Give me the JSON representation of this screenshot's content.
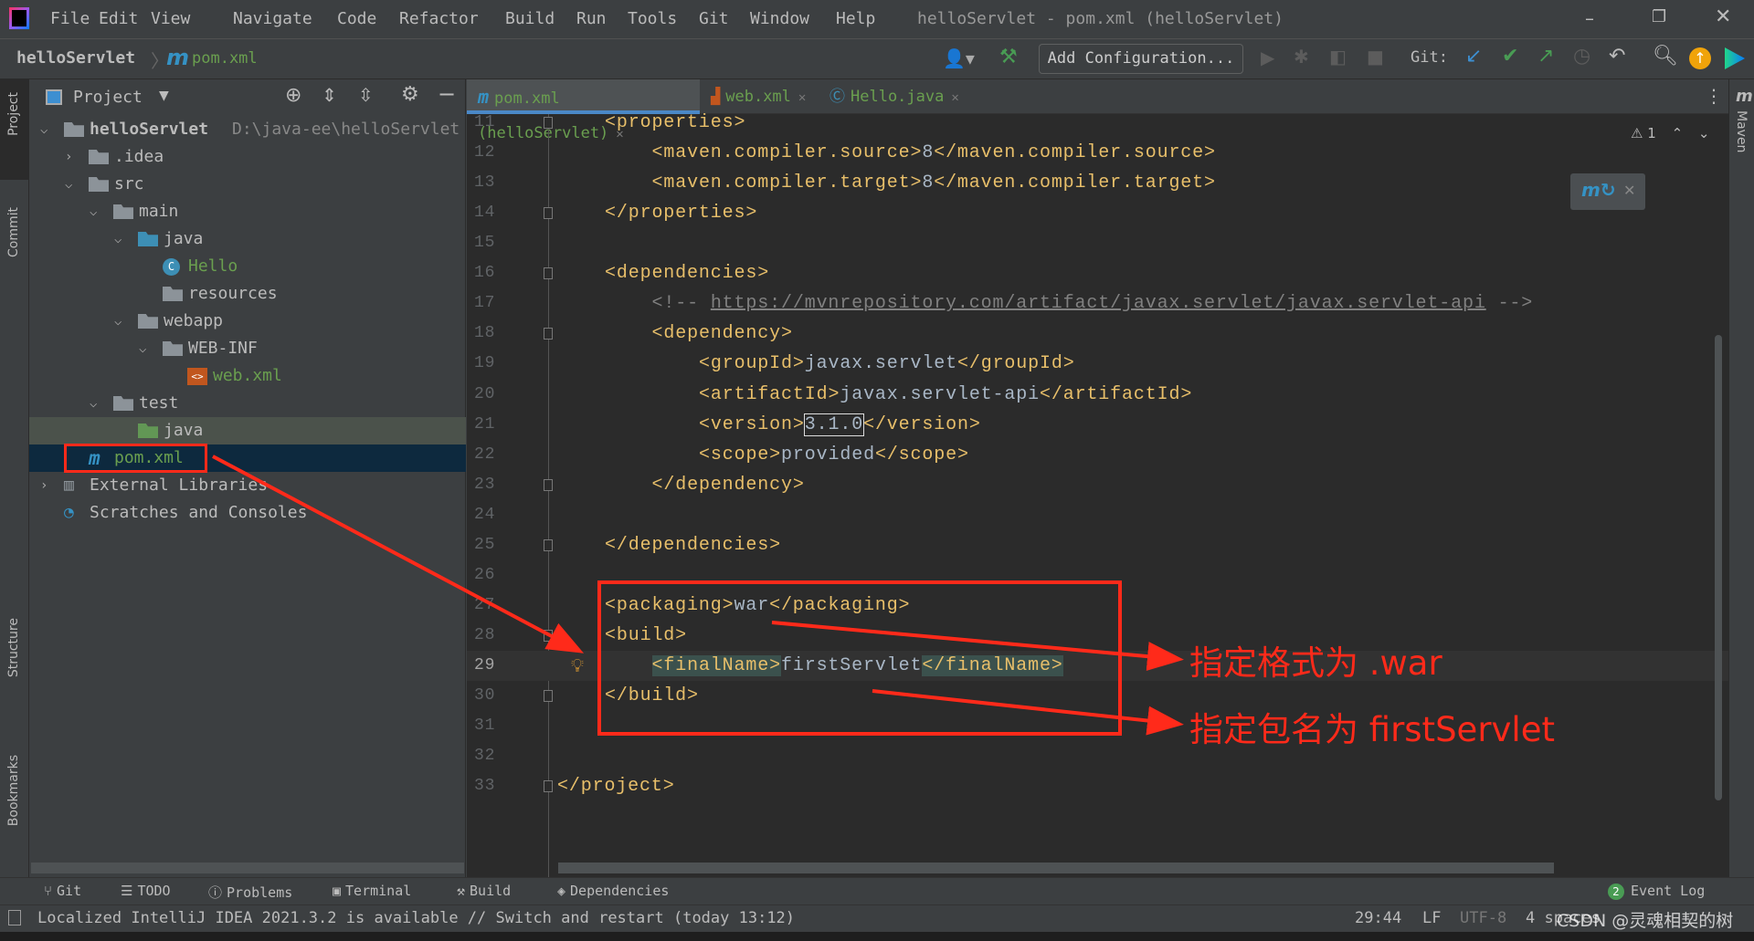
{
  "window": {
    "title": "helloServlet - pom.xml (helloServlet)"
  },
  "menu": [
    "File",
    "Edit",
    "View",
    "Navigate",
    "Code",
    "Refactor",
    "Build",
    "Run",
    "Tools",
    "Git",
    "Window",
    "Help"
  ],
  "breadcrumb": {
    "project": "helloServlet",
    "file": "pom.xml"
  },
  "toolbar": {
    "add_config": "Add Configuration...",
    "git_label": "Git:"
  },
  "left_stripe": [
    "Project",
    "Commit",
    "Structure",
    "Bookmarks"
  ],
  "right_stripe": [
    "Maven"
  ],
  "project_panel": {
    "title": "Project",
    "tree": [
      {
        "label": "helloServlet",
        "path": "D:\\java-ee\\helloServlet",
        "depth": 0,
        "arrow": "down",
        "icon": "module",
        "color": "#bbbbbb",
        "bold": true
      },
      {
        "label": ".idea",
        "depth": 1,
        "arrow": "right",
        "icon": "folder",
        "color": "#bbbbbb"
      },
      {
        "label": "src",
        "depth": 1,
        "arrow": "down",
        "icon": "folder",
        "color": "#bbbbbb"
      },
      {
        "label": "main",
        "depth": 2,
        "arrow": "down",
        "icon": "folder",
        "color": "#bbbbbb"
      },
      {
        "label": "java",
        "depth": 3,
        "arrow": "down",
        "icon": "folder-blue",
        "color": "#bbbbbb"
      },
      {
        "label": "Hello",
        "depth": 4,
        "arrow": "",
        "icon": "class",
        "color": "#6a9f4f"
      },
      {
        "label": "resources",
        "depth": 4,
        "arrow": "",
        "icon": "folder-res",
        "color": "#bbbbbb"
      },
      {
        "label": "webapp",
        "depth": 3,
        "arrow": "down",
        "icon": "folder",
        "color": "#bbbbbb"
      },
      {
        "label": "WEB-INF",
        "depth": 4,
        "arrow": "down",
        "icon": "folder",
        "color": "#bbbbbb"
      },
      {
        "label": "web.xml",
        "depth": 5,
        "arrow": "",
        "icon": "xml",
        "color": "#6a9f4f"
      },
      {
        "label": "test",
        "depth": 2,
        "arrow": "down",
        "icon": "folder",
        "color": "#bbbbbb"
      },
      {
        "label": "java",
        "depth": 3,
        "arrow": "",
        "icon": "folder-green",
        "color": "#bbbbbb",
        "state": "highlighted"
      },
      {
        "label": "pom.xml",
        "depth": 1,
        "arrow": "",
        "icon": "maven",
        "color": "#6a9f4f",
        "state": "selected"
      },
      {
        "label": "External Libraries",
        "depth": 0,
        "arrow": "right",
        "icon": "libraries",
        "color": "#bbbbbb"
      },
      {
        "label": "Scratches and Consoles",
        "depth": 0,
        "arrow": "",
        "icon": "scratches",
        "color": "#bbbbbb"
      }
    ]
  },
  "tabs": [
    {
      "label": "pom.xml (helloServlet)",
      "icon": "maven",
      "active": true
    },
    {
      "label": "web.xml",
      "icon": "xml"
    },
    {
      "label": "Hello.java",
      "icon": "class"
    }
  ],
  "inspection": {
    "warnings": "1"
  },
  "code": [
    {
      "n": "11",
      "indent": 0,
      "tokens": [
        [
          "tag",
          "<properties>"
        ]
      ]
    },
    {
      "n": "12",
      "indent": 1,
      "tokens": [
        [
          "tag",
          "<maven.compiler.source>"
        ],
        [
          "txt",
          "8"
        ],
        [
          "tag",
          "</maven.compiler.source>"
        ]
      ]
    },
    {
      "n": "13",
      "indent": 1,
      "tokens": [
        [
          "tag",
          "<maven.compiler.target>"
        ],
        [
          "txt",
          "8"
        ],
        [
          "tag",
          "</maven.compiler.target>"
        ]
      ]
    },
    {
      "n": "14",
      "indent": 0,
      "tokens": [
        [
          "tag",
          "</properties>"
        ]
      ]
    },
    {
      "n": "15",
      "indent": 0,
      "tokens": []
    },
    {
      "n": "16",
      "indent": 0,
      "tokens": [
        [
          "tag",
          "<dependencies>"
        ]
      ]
    },
    {
      "n": "17",
      "indent": 1,
      "tokens": [
        [
          "cmt",
          "<!-- "
        ],
        [
          "url",
          "https://mvnrepository.com/artifact/javax.servlet/javax.servlet-api"
        ],
        [
          "cmt",
          " -->"
        ]
      ]
    },
    {
      "n": "18",
      "indent": 1,
      "tokens": [
        [
          "tag",
          "<dependency>"
        ]
      ]
    },
    {
      "n": "19",
      "indent": 2,
      "tokens": [
        [
          "tag",
          "<groupId>"
        ],
        [
          "txt",
          "javax.servlet"
        ],
        [
          "tag",
          "</groupId>"
        ]
      ]
    },
    {
      "n": "20",
      "indent": 2,
      "tokens": [
        [
          "tag",
          "<artifactId>"
        ],
        [
          "txt",
          "javax.servlet-api"
        ],
        [
          "tag",
          "</artifactId>"
        ]
      ]
    },
    {
      "n": "21",
      "indent": 2,
      "tokens": [
        [
          "tag",
          "<version>"
        ],
        [
          "txt box",
          "3.1.0"
        ],
        [
          "tag",
          "</version>"
        ]
      ]
    },
    {
      "n": "22",
      "indent": 2,
      "tokens": [
        [
          "tag",
          "<scope>"
        ],
        [
          "txt",
          "provided"
        ],
        [
          "tag",
          "</scope>"
        ]
      ]
    },
    {
      "n": "23",
      "indent": 1,
      "tokens": [
        [
          "tag",
          "</dependency>"
        ]
      ]
    },
    {
      "n": "24",
      "indent": 0,
      "tokens": []
    },
    {
      "n": "25",
      "indent": 0,
      "tokens": [
        [
          "tag",
          "</dependencies>"
        ]
      ]
    },
    {
      "n": "26",
      "indent": 0,
      "tokens": []
    },
    {
      "n": "27",
      "indent": 0,
      "tokens": [
        [
          "tag",
          "<packaging>"
        ],
        [
          "txt",
          "war"
        ],
        [
          "tag",
          "</packaging>"
        ]
      ]
    },
    {
      "n": "28",
      "indent": 0,
      "tokens": [
        [
          "tag",
          "<build>"
        ]
      ]
    },
    {
      "n": "29",
      "indent": 1,
      "tokens": [
        [
          "tag hl",
          "<finalName>"
        ],
        [
          "txt",
          "firstServlet"
        ],
        [
          "tag hl",
          "</finalName>"
        ]
      ],
      "current": true
    },
    {
      "n": "30",
      "indent": 0,
      "tokens": [
        [
          "tag",
          "</build>"
        ]
      ]
    },
    {
      "n": "31",
      "indent": 0,
      "tokens": []
    },
    {
      "n": "32",
      "indent": 0,
      "tokens": []
    },
    {
      "n": "33",
      "indent": -1,
      "tokens": [
        [
          "tag",
          "</project>"
        ]
      ]
    }
  ],
  "annotations": {
    "format": "指定格式为 .war",
    "name": "指定包名为 firstServlet",
    "color": "#ff2a1a"
  },
  "bottom_tools": [
    "Git",
    "TODO",
    "Problems",
    "Terminal",
    "Build",
    "Dependencies"
  ],
  "event_log": {
    "label": "Event Log",
    "count": "2"
  },
  "status": {
    "message": "Localized IntelliJ IDEA 2021.3.2 is available // Switch and restart (today 13:12)",
    "position": "29:44",
    "line_sep": "LF",
    "encoding": "UTF-8",
    "indent": "4 spaces"
  },
  "watermark": "CSDN @灵魂相契的树"
}
